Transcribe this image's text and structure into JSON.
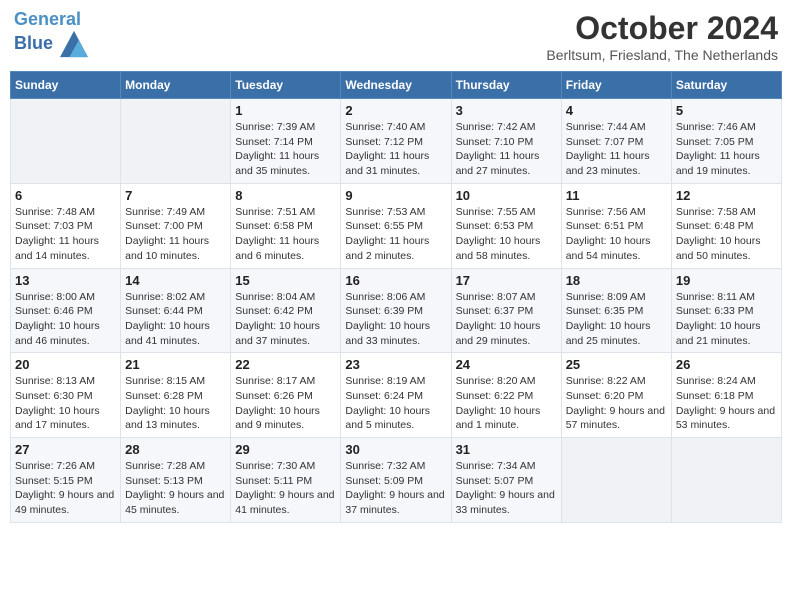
{
  "header": {
    "logo_line1": "General",
    "logo_line2": "Blue",
    "month": "October 2024",
    "location": "Berltsum, Friesland, The Netherlands"
  },
  "weekdays": [
    "Sunday",
    "Monday",
    "Tuesday",
    "Wednesday",
    "Thursday",
    "Friday",
    "Saturday"
  ],
  "weeks": [
    [
      {
        "day": "",
        "info": ""
      },
      {
        "day": "",
        "info": ""
      },
      {
        "day": "1",
        "info": "Sunrise: 7:39 AM\nSunset: 7:14 PM\nDaylight: 11 hours and 35 minutes."
      },
      {
        "day": "2",
        "info": "Sunrise: 7:40 AM\nSunset: 7:12 PM\nDaylight: 11 hours and 31 minutes."
      },
      {
        "day": "3",
        "info": "Sunrise: 7:42 AM\nSunset: 7:10 PM\nDaylight: 11 hours and 27 minutes."
      },
      {
        "day": "4",
        "info": "Sunrise: 7:44 AM\nSunset: 7:07 PM\nDaylight: 11 hours and 23 minutes."
      },
      {
        "day": "5",
        "info": "Sunrise: 7:46 AM\nSunset: 7:05 PM\nDaylight: 11 hours and 19 minutes."
      }
    ],
    [
      {
        "day": "6",
        "info": "Sunrise: 7:48 AM\nSunset: 7:03 PM\nDaylight: 11 hours and 14 minutes."
      },
      {
        "day": "7",
        "info": "Sunrise: 7:49 AM\nSunset: 7:00 PM\nDaylight: 11 hours and 10 minutes."
      },
      {
        "day": "8",
        "info": "Sunrise: 7:51 AM\nSunset: 6:58 PM\nDaylight: 11 hours and 6 minutes."
      },
      {
        "day": "9",
        "info": "Sunrise: 7:53 AM\nSunset: 6:55 PM\nDaylight: 11 hours and 2 minutes."
      },
      {
        "day": "10",
        "info": "Sunrise: 7:55 AM\nSunset: 6:53 PM\nDaylight: 10 hours and 58 minutes."
      },
      {
        "day": "11",
        "info": "Sunrise: 7:56 AM\nSunset: 6:51 PM\nDaylight: 10 hours and 54 minutes."
      },
      {
        "day": "12",
        "info": "Sunrise: 7:58 AM\nSunset: 6:48 PM\nDaylight: 10 hours and 50 minutes."
      }
    ],
    [
      {
        "day": "13",
        "info": "Sunrise: 8:00 AM\nSunset: 6:46 PM\nDaylight: 10 hours and 46 minutes."
      },
      {
        "day": "14",
        "info": "Sunrise: 8:02 AM\nSunset: 6:44 PM\nDaylight: 10 hours and 41 minutes."
      },
      {
        "day": "15",
        "info": "Sunrise: 8:04 AM\nSunset: 6:42 PM\nDaylight: 10 hours and 37 minutes."
      },
      {
        "day": "16",
        "info": "Sunrise: 8:06 AM\nSunset: 6:39 PM\nDaylight: 10 hours and 33 minutes."
      },
      {
        "day": "17",
        "info": "Sunrise: 8:07 AM\nSunset: 6:37 PM\nDaylight: 10 hours and 29 minutes."
      },
      {
        "day": "18",
        "info": "Sunrise: 8:09 AM\nSunset: 6:35 PM\nDaylight: 10 hours and 25 minutes."
      },
      {
        "day": "19",
        "info": "Sunrise: 8:11 AM\nSunset: 6:33 PM\nDaylight: 10 hours and 21 minutes."
      }
    ],
    [
      {
        "day": "20",
        "info": "Sunrise: 8:13 AM\nSunset: 6:30 PM\nDaylight: 10 hours and 17 minutes."
      },
      {
        "day": "21",
        "info": "Sunrise: 8:15 AM\nSunset: 6:28 PM\nDaylight: 10 hours and 13 minutes."
      },
      {
        "day": "22",
        "info": "Sunrise: 8:17 AM\nSunset: 6:26 PM\nDaylight: 10 hours and 9 minutes."
      },
      {
        "day": "23",
        "info": "Sunrise: 8:19 AM\nSunset: 6:24 PM\nDaylight: 10 hours and 5 minutes."
      },
      {
        "day": "24",
        "info": "Sunrise: 8:20 AM\nSunset: 6:22 PM\nDaylight: 10 hours and 1 minute."
      },
      {
        "day": "25",
        "info": "Sunrise: 8:22 AM\nSunset: 6:20 PM\nDaylight: 9 hours and 57 minutes."
      },
      {
        "day": "26",
        "info": "Sunrise: 8:24 AM\nSunset: 6:18 PM\nDaylight: 9 hours and 53 minutes."
      }
    ],
    [
      {
        "day": "27",
        "info": "Sunrise: 7:26 AM\nSunset: 5:15 PM\nDaylight: 9 hours and 49 minutes."
      },
      {
        "day": "28",
        "info": "Sunrise: 7:28 AM\nSunset: 5:13 PM\nDaylight: 9 hours and 45 minutes."
      },
      {
        "day": "29",
        "info": "Sunrise: 7:30 AM\nSunset: 5:11 PM\nDaylight: 9 hours and 41 minutes."
      },
      {
        "day": "30",
        "info": "Sunrise: 7:32 AM\nSunset: 5:09 PM\nDaylight: 9 hours and 37 minutes."
      },
      {
        "day": "31",
        "info": "Sunrise: 7:34 AM\nSunset: 5:07 PM\nDaylight: 9 hours and 33 minutes."
      },
      {
        "day": "",
        "info": ""
      },
      {
        "day": "",
        "info": ""
      }
    ]
  ]
}
